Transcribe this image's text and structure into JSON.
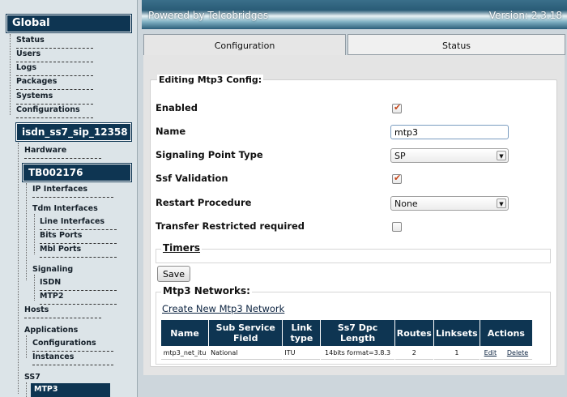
{
  "header": {
    "brand": "Powered by Telcobridges",
    "version": "Version: 2.3.18"
  },
  "tabs": [
    {
      "label": "Configuration",
      "active": true
    },
    {
      "label": "Status",
      "active": false
    }
  ],
  "sidebar": {
    "global_title": "Global",
    "global_items": [
      "Status",
      "Users",
      "Logs",
      "Packages",
      "Systems",
      "Configurations"
    ],
    "config_title": "isdn_ss7_sip_12358",
    "hardware": "Hardware",
    "device_title": "TB002176",
    "ip_interfaces": "IP Interfaces",
    "tdm_interfaces": "Tdm Interfaces",
    "tdm_children": [
      "Line Interfaces",
      "Bits Ports",
      "Mbl Ports"
    ],
    "signaling": "Signaling",
    "signaling_children": [
      "ISDN",
      "MTP2"
    ],
    "hosts": "Hosts",
    "applications": "Applications",
    "application_children": [
      "Configurations",
      "Instances"
    ],
    "ss7": "SS7",
    "ss7_active": "MTP3"
  },
  "form": {
    "title": "Editing Mtp3 Config:",
    "enabled_label": "Enabled",
    "enabled": true,
    "name_label": "Name",
    "name_value": "mtp3",
    "spt_label": "Signaling Point Type",
    "spt_value": "SP",
    "ssf_label": "Ssf Validation",
    "ssf": true,
    "restart_label": "Restart Procedure",
    "restart_value": "None",
    "transfer_label": "Transfer Restricted required",
    "transfer": false,
    "timers_label": "Timers",
    "save_label": "Save"
  },
  "networks": {
    "title": "Mtp3 Networks:",
    "create_link": "Create New Mtp3 Network",
    "headers": [
      "Name",
      "Sub Service Field",
      "Link type",
      "Ss7 Dpc Length",
      "Routes",
      "Linksets",
      "Actions"
    ],
    "rows": [
      {
        "name": "mtp3_net_itu",
        "ssf": "National",
        "link_type": "ITU",
        "dpc": "14bits format=3.8.3",
        "routes": "2",
        "linksets": "1",
        "edit": "Edit",
        "delete": "Delete"
      }
    ]
  },
  "colors": {
    "header_bg": "#0e3552",
    "check": "#c5461a"
  }
}
